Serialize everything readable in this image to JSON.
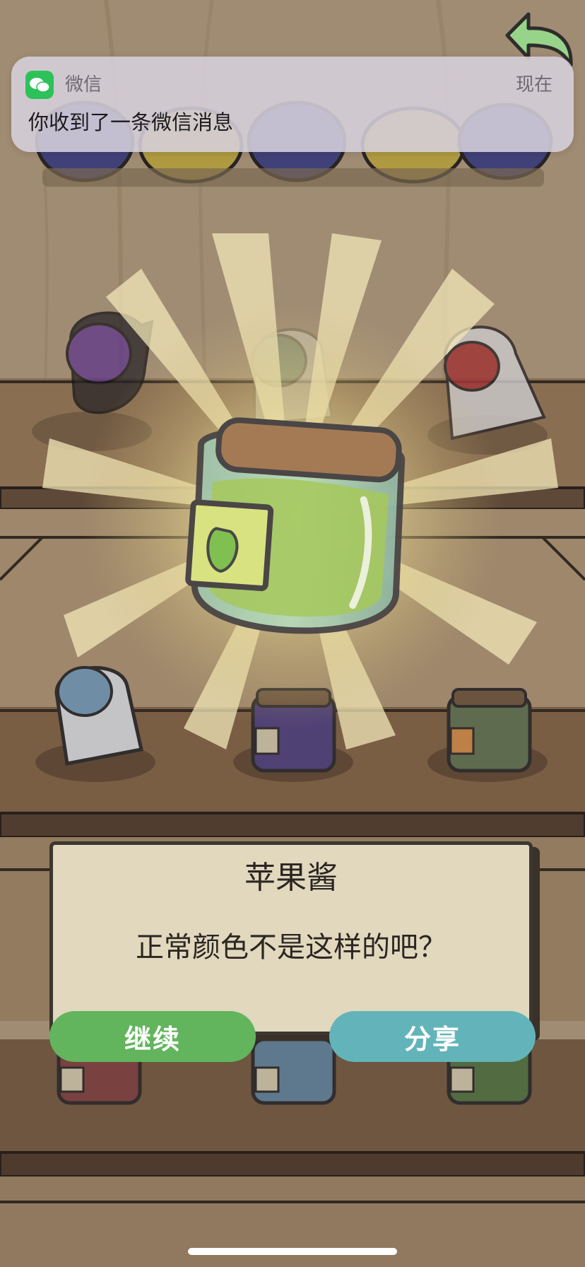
{
  "notification": {
    "app_name": "微信",
    "time": "现在",
    "message": "你收到了一条微信消息"
  },
  "item": {
    "name": "苹果酱",
    "comment": "正常颜色不是这样的吧？"
  },
  "buttons": {
    "continue_label": "继续",
    "share_label": "分享"
  },
  "icons": {
    "app_icon": "wechat-icon",
    "back": "back-arrow-icon"
  },
  "colors": {
    "continue_button": "#62b55d",
    "share_button": "#63b4ba",
    "dialog_bg": "#e2d8be",
    "wechat_green": "#2dc15a"
  }
}
